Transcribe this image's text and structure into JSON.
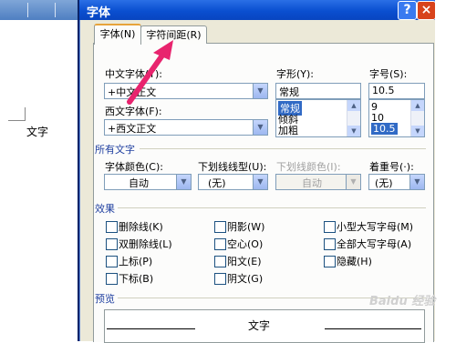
{
  "document": {
    "text": "文字"
  },
  "dialog": {
    "title": "字体",
    "help_button": "?",
    "close_button": "×",
    "tabs": [
      {
        "label": "字体(N)",
        "active": true
      },
      {
        "label": "字符间距(R)",
        "active": false
      }
    ]
  },
  "font": {
    "chinese_font_label": "中文字体(T):",
    "chinese_font_value": "+中文正文",
    "western_font_label": "西文字体(F):",
    "western_font_value": "+西文正文",
    "style_label": "字形(Y):",
    "style_value": "常规",
    "style_options": [
      "常规",
      "倾斜",
      "加粗"
    ],
    "size_label": "字号(S):",
    "size_value": "10.5",
    "size_options": [
      "9",
      "10",
      "10.5"
    ]
  },
  "all_text": {
    "section_label": "所有文字",
    "color_label": "字体颜色(C):",
    "color_value": "自动",
    "underline_label": "下划线线型(U):",
    "underline_value": "(无)",
    "underline_color_label": "下划线颜色(I):",
    "underline_color_value": "自动",
    "emphasis_label": "着重号(·):",
    "emphasis_value": "(无)"
  },
  "effects": {
    "section_label": "效果",
    "items": [
      "删除线(K)",
      "双删除线(L)",
      "上标(P)",
      "下标(B)",
      "阴影(W)",
      "空心(O)",
      "阳文(E)",
      "阴文(G)",
      "小型大写字母(M)",
      "全部大写字母(A)",
      "隐藏(H)"
    ]
  },
  "preview": {
    "section_label": "预览",
    "text": "文字"
  },
  "annotation": {
    "arrow_color": "#e8246e"
  },
  "watermark": {
    "text": "Baidu 经验"
  }
}
